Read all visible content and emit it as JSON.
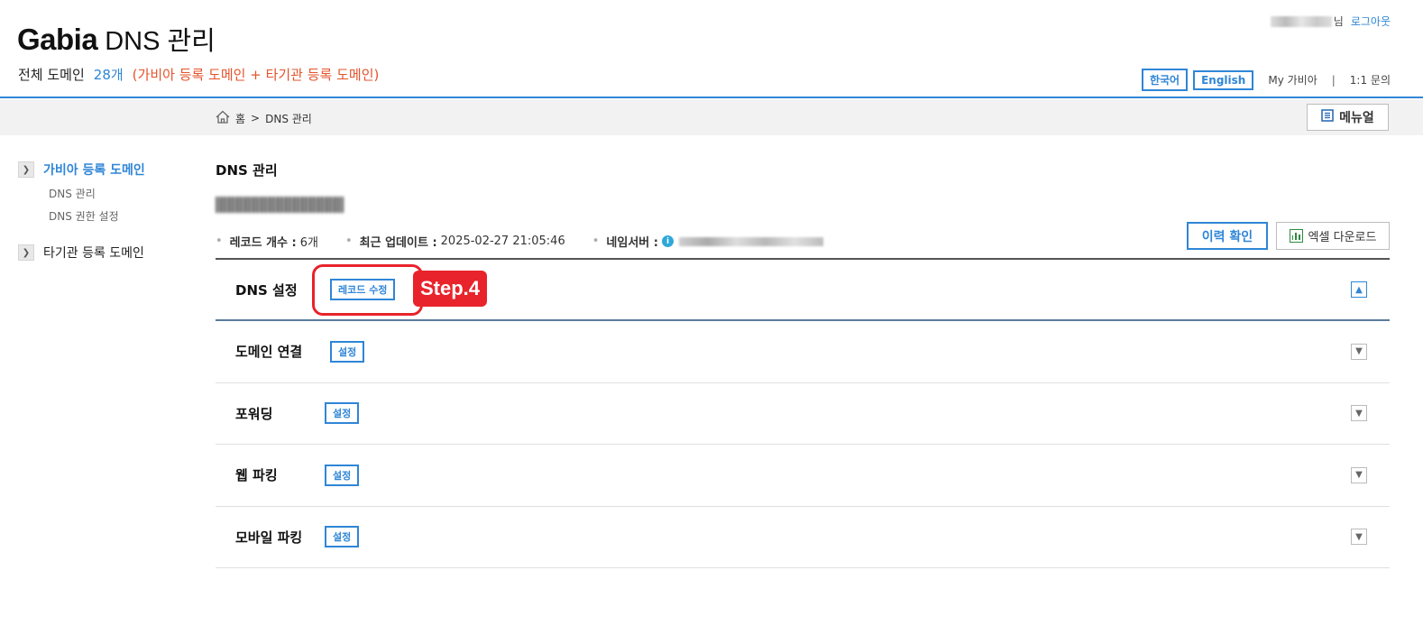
{
  "header": {
    "brand": "Gabia",
    "title": "DNS 관리",
    "summary_label": "전체 도메인",
    "summary_count": "28개",
    "summary_note": "(가비아 등록 도메인 + 타기관 등록 도메인)",
    "user_suffix": "님",
    "logout": "로그아웃",
    "lang_ko": "한국어",
    "lang_en": "English",
    "my_gabia": "My 가비아",
    "separator": "|",
    "inquiry": "1:1 문의"
  },
  "breadcrumb": {
    "home": "홈",
    "sep": ">",
    "current": "DNS 관리",
    "manual": "메뉴얼"
  },
  "sidebar": {
    "groups": [
      {
        "label": "가비아 등록 도메인",
        "items": [
          "DNS 관리",
          "DNS 권한 설정"
        ]
      },
      {
        "label": "타기관 등록 도메인",
        "items": []
      }
    ]
  },
  "main": {
    "title": "DNS 관리",
    "record_count_key": "레코드 개수 :",
    "record_count_val": "6개",
    "updated_key": "최근 업데이트 :",
    "updated_val": "2025-02-27 21:05:46",
    "ns_key": "네임서버 :",
    "history_button": "이력 확인",
    "excel_button": "엑셀 다운로드"
  },
  "sections": [
    {
      "title": "DNS 설정",
      "button": "레코드 수정",
      "expanded": true
    },
    {
      "title": "도메인 연결",
      "button": "설정",
      "expanded": false
    },
    {
      "title": "포워딩",
      "button": "설정",
      "expanded": false
    },
    {
      "title": "웹 파킹",
      "button": "설정",
      "expanded": false
    },
    {
      "title": "모바일 파킹",
      "button": "설정",
      "expanded": false
    }
  ],
  "annotation": {
    "step_label": "Step.4",
    "color": "#e8232b"
  },
  "colors": {
    "accent": "#2f86d6",
    "note": "#e4542c"
  },
  "icons": {
    "home": "home-icon",
    "manual": "document-icon",
    "info": "info-icon",
    "excel": "chart-icon",
    "toggle_up": "chevron-up-icon",
    "toggle_down": "chevron-down-icon"
  }
}
